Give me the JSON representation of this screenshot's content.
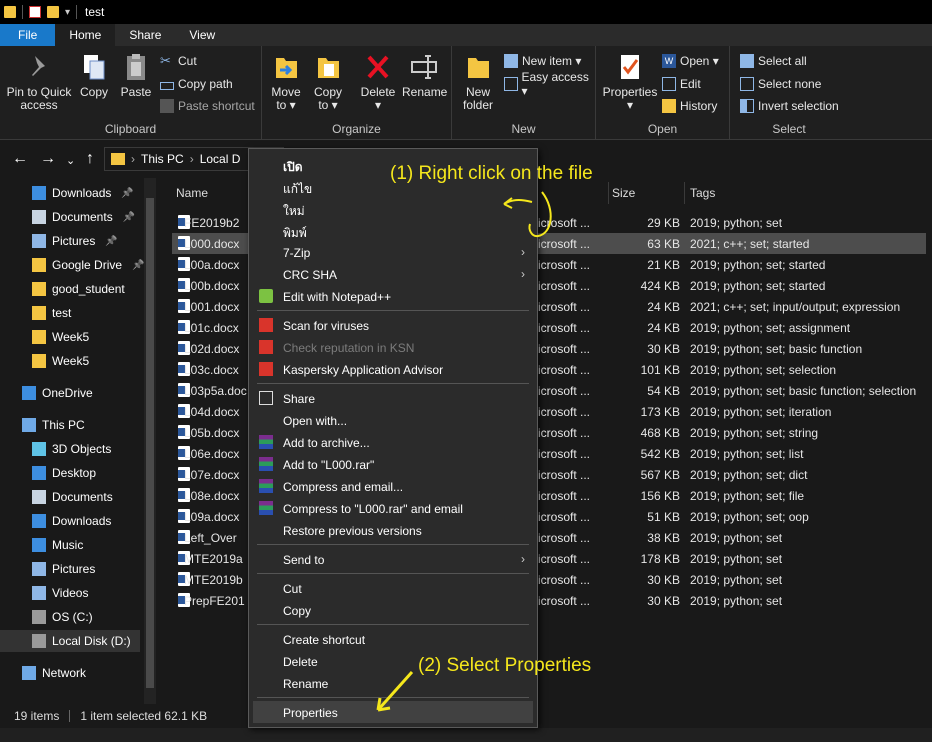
{
  "window": {
    "title": "test"
  },
  "ribbon_tabs": [
    "File",
    "Home",
    "Share",
    "View"
  ],
  "ribbon": {
    "clipboard": {
      "label": "Clipboard",
      "pin_to_quick": [
        "Pin to Quick",
        "access"
      ],
      "copy": "Copy",
      "paste": "Paste",
      "cut": "Cut",
      "copy_path": "Copy path",
      "paste_shortcut": "Paste shortcut"
    },
    "organize": {
      "label": "Organize",
      "move_to": [
        "Move",
        "to ▾"
      ],
      "copy_to": [
        "Copy",
        "to ▾"
      ],
      "delete": [
        "Delete",
        "▾"
      ],
      "rename": "Rename"
    },
    "new": {
      "label": "New",
      "new_folder": [
        "New",
        "folder"
      ],
      "new_item": "New item ▾",
      "easy_access": "Easy access ▾"
    },
    "open": {
      "label": "Open",
      "properties": [
        "Properties",
        "▾"
      ],
      "open": "Open ▾",
      "edit": "Edit",
      "history": "History"
    },
    "select": {
      "label": "Select",
      "select_all": "Select all",
      "select_none": "Select none",
      "invert_selection": "Invert selection"
    }
  },
  "address": {
    "crumbs": [
      "This PC",
      "Local D"
    ]
  },
  "nav": [
    {
      "label": "Downloads",
      "icon": "download-arrow-icon",
      "pinned": true,
      "indent": 1
    },
    {
      "label": "Documents",
      "icon": "documents-icon",
      "pinned": true,
      "indent": 1
    },
    {
      "label": "Pictures",
      "icon": "pictures-icon",
      "pinned": true,
      "indent": 1
    },
    {
      "label": "Google Drive",
      "icon": "folder-icon",
      "pinned": true,
      "indent": 1
    },
    {
      "label": "good_student",
      "icon": "folder-icon",
      "pinned": false,
      "indent": 1
    },
    {
      "label": "test",
      "icon": "folder-icon",
      "pinned": false,
      "indent": 1
    },
    {
      "label": "Week5",
      "icon": "folder-icon",
      "pinned": false,
      "indent": 1
    },
    {
      "label": "Week5",
      "icon": "folder-icon",
      "pinned": false,
      "indent": 1
    },
    {
      "label": "OneDrive",
      "icon": "cloud-icon",
      "pinned": false,
      "indent": 0
    },
    {
      "label": "This PC",
      "icon": "computer-icon",
      "pinned": false,
      "indent": 0
    },
    {
      "label": "3D Objects",
      "icon": "cube-icon",
      "pinned": false,
      "indent": 1
    },
    {
      "label": "Desktop",
      "icon": "desktop-icon",
      "pinned": false,
      "indent": 1
    },
    {
      "label": "Documents",
      "icon": "documents-icon",
      "pinned": false,
      "indent": 1
    },
    {
      "label": "Downloads",
      "icon": "download-arrow-icon",
      "pinned": false,
      "indent": 1
    },
    {
      "label": "Music",
      "icon": "music-icon",
      "pinned": false,
      "indent": 1
    },
    {
      "label": "Pictures",
      "icon": "pictures-icon",
      "pinned": false,
      "indent": 1
    },
    {
      "label": "Videos",
      "icon": "videos-icon",
      "pinned": false,
      "indent": 1
    },
    {
      "label": "OS (C:)",
      "icon": "drive-icon",
      "pinned": false,
      "indent": 1
    },
    {
      "label": "Local Disk (D:)",
      "icon": "drive-icon",
      "pinned": false,
      "indent": 1
    },
    {
      "label": "Network",
      "icon": "network-icon",
      "pinned": false,
      "indent": 0
    }
  ],
  "columns": {
    "name": "Name",
    "size": "Size",
    "tags": "Tags"
  },
  "files": [
    {
      "name": "FE2019b2",
      "type": "icrosoft ...",
      "size": "29 KB",
      "tags": "2019; python; set"
    },
    {
      "name": "L000.docx",
      "type": "icrosoft ...",
      "size": "63 KB",
      "tags": "2021; c++; set; started"
    },
    {
      "name": "L00a.docx",
      "type": "icrosoft ...",
      "size": "21 KB",
      "tags": "2019; python; set; started"
    },
    {
      "name": "L00b.docx",
      "type": "icrosoft ...",
      "size": "424 KB",
      "tags": "2019; python; set; started"
    },
    {
      "name": "L001.docx",
      "type": "icrosoft ...",
      "size": "24 KB",
      "tags": "2021; c++; set; input/output; expression"
    },
    {
      "name": "L01c.docx",
      "type": "icrosoft ...",
      "size": "24 KB",
      "tags": "2019; python; set; assignment"
    },
    {
      "name": "L02d.docx",
      "type": "icrosoft ...",
      "size": "30 KB",
      "tags": "2019; python; set; basic function"
    },
    {
      "name": "L03c.docx",
      "type": "icrosoft ...",
      "size": "101 KB",
      "tags": "2019; python; set; selection"
    },
    {
      "name": "L03p5a.doc",
      "type": "icrosoft ...",
      "size": "54 KB",
      "tags": "2019; python; set; basic function; selection"
    },
    {
      "name": "L04d.docx",
      "type": "icrosoft ...",
      "size": "173 KB",
      "tags": "2019; python; set; iteration"
    },
    {
      "name": "L05b.docx",
      "type": "icrosoft ...",
      "size": "468 KB",
      "tags": "2019; python; set; string"
    },
    {
      "name": "L06e.docx",
      "type": "icrosoft ...",
      "size": "542 KB",
      "tags": "2019; python; set; list"
    },
    {
      "name": "L07e.docx",
      "type": "icrosoft ...",
      "size": "567 KB",
      "tags": "2019; python; set; dict"
    },
    {
      "name": "L08e.docx",
      "type": "icrosoft ...",
      "size": "156 KB",
      "tags": "2019; python; set; file"
    },
    {
      "name": "L09a.docx",
      "type": "icrosoft ...",
      "size": "51 KB",
      "tags": "2019; python; set; oop"
    },
    {
      "name": "Left_Over",
      "type": "icrosoft ...",
      "size": "38 KB",
      "tags": "2019; python; set"
    },
    {
      "name": "MTE2019a",
      "type": "icrosoft ...",
      "size": "178 KB",
      "tags": "2019; python; set"
    },
    {
      "name": "MTE2019b",
      "type": "icrosoft ...",
      "size": "30 KB",
      "tags": "2019; python; set"
    },
    {
      "name": "PrepFE201",
      "type": "icrosoft ...",
      "size": "30 KB",
      "tags": "2019; python; set"
    }
  ],
  "selected_file_index": 1,
  "context_menu": [
    {
      "label": "เปิด",
      "icon": "",
      "bold": true
    },
    {
      "label": "แก้ไข",
      "icon": ""
    },
    {
      "label": "ใหม่",
      "icon": ""
    },
    {
      "label": "พิมพ์",
      "icon": ""
    },
    {
      "label": "7-Zip",
      "icon": "",
      "submenu": true
    },
    {
      "label": "CRC SHA",
      "icon": "",
      "submenu": true
    },
    {
      "label": "Edit with Notepad++",
      "icon": "notepadpp-icon"
    },
    {
      "sep": true
    },
    {
      "label": "Scan for viruses",
      "icon": "kaspersky-icon"
    },
    {
      "label": "Check reputation in KSN",
      "icon": "kaspersky-icon",
      "disabled": true
    },
    {
      "label": "Kaspersky Application Advisor",
      "icon": "kaspersky-icon"
    },
    {
      "sep": true
    },
    {
      "label": "Share",
      "icon": "share-icon"
    },
    {
      "label": "Open with...",
      "icon": ""
    },
    {
      "label": "Add to archive...",
      "icon": "winrar-icon"
    },
    {
      "label": "Add to \"L000.rar\"",
      "icon": "winrar-icon"
    },
    {
      "label": "Compress and email...",
      "icon": "winrar-icon"
    },
    {
      "label": "Compress to \"L000.rar\" and email",
      "icon": "winrar-icon"
    },
    {
      "label": "Restore previous versions",
      "icon": ""
    },
    {
      "sep": true
    },
    {
      "label": "Send to",
      "icon": "",
      "submenu": true
    },
    {
      "sep": true
    },
    {
      "label": "Cut",
      "icon": ""
    },
    {
      "label": "Copy",
      "icon": ""
    },
    {
      "sep": true
    },
    {
      "label": "Create shortcut",
      "icon": ""
    },
    {
      "label": "Delete",
      "icon": ""
    },
    {
      "label": "Rename",
      "icon": ""
    },
    {
      "sep": true
    },
    {
      "label": "Properties",
      "icon": "",
      "hover": true
    }
  ],
  "status": {
    "item_count": "19 items",
    "selection": "1 item selected  62.1 KB"
  },
  "annotations": {
    "step1": "(1) Right click on the file",
    "step2": "(2) Select Properties"
  },
  "colors": {
    "accent": "#1979ca",
    "annotation": "#f5e71c",
    "folder": "#f4c542"
  }
}
